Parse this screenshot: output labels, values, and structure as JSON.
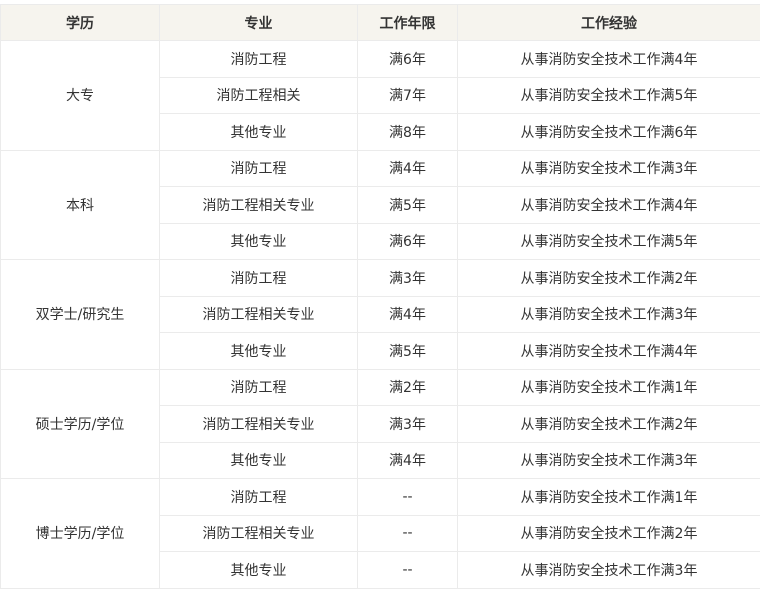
{
  "headers": [
    "学历",
    "专业",
    "工作年限",
    "工作经验"
  ],
  "groups": [
    {
      "education": "大专",
      "rows": [
        {
          "major": "消防工程",
          "years": "满6年",
          "experience": "从事消防安全技术工作满4年"
        },
        {
          "major": "消防工程相关",
          "years": "满7年",
          "experience": "从事消防安全技术工作满5年"
        },
        {
          "major": "其他专业",
          "years": "满8年",
          "experience": "从事消防安全技术工作满6年"
        }
      ]
    },
    {
      "education": "本科",
      "rows": [
        {
          "major": "消防工程",
          "years": "满4年",
          "experience": "从事消防安全技术工作满3年"
        },
        {
          "major": "消防工程相关专业",
          "years": "满5年",
          "experience": "从事消防安全技术工作满4年"
        },
        {
          "major": "其他专业",
          "years": "满6年",
          "experience": "从事消防安全技术工作满5年"
        }
      ]
    },
    {
      "education": "双学士/研究生",
      "rows": [
        {
          "major": "消防工程",
          "years": "满3年",
          "experience": "从事消防安全技术工作满2年"
        },
        {
          "major": "消防工程相关专业",
          "years": "满4年",
          "experience": "从事消防安全技术工作满3年"
        },
        {
          "major": "其他专业",
          "years": "满5年",
          "experience": "从事消防安全技术工作满4年"
        }
      ]
    },
    {
      "education": "硕士学历/学位",
      "rows": [
        {
          "major": "消防工程",
          "years": "满2年",
          "experience": "从事消防安全技术工作满1年"
        },
        {
          "major": "消防工程相关专业",
          "years": "满3年",
          "experience": "从事消防安全技术工作满2年"
        },
        {
          "major": "其他专业",
          "years": "满4年",
          "experience": "从事消防安全技术工作满3年"
        }
      ]
    },
    {
      "education": "博士学历/学位",
      "rows": [
        {
          "major": "消防工程",
          "years": "--",
          "experience": "从事消防安全技术工作满1年"
        },
        {
          "major": "消防工程相关专业",
          "years": "--",
          "experience": "从事消防安全技术工作满2年"
        },
        {
          "major": "其他专业",
          "years": "--",
          "experience": "从事消防安全技术工作满3年"
        }
      ]
    }
  ]
}
